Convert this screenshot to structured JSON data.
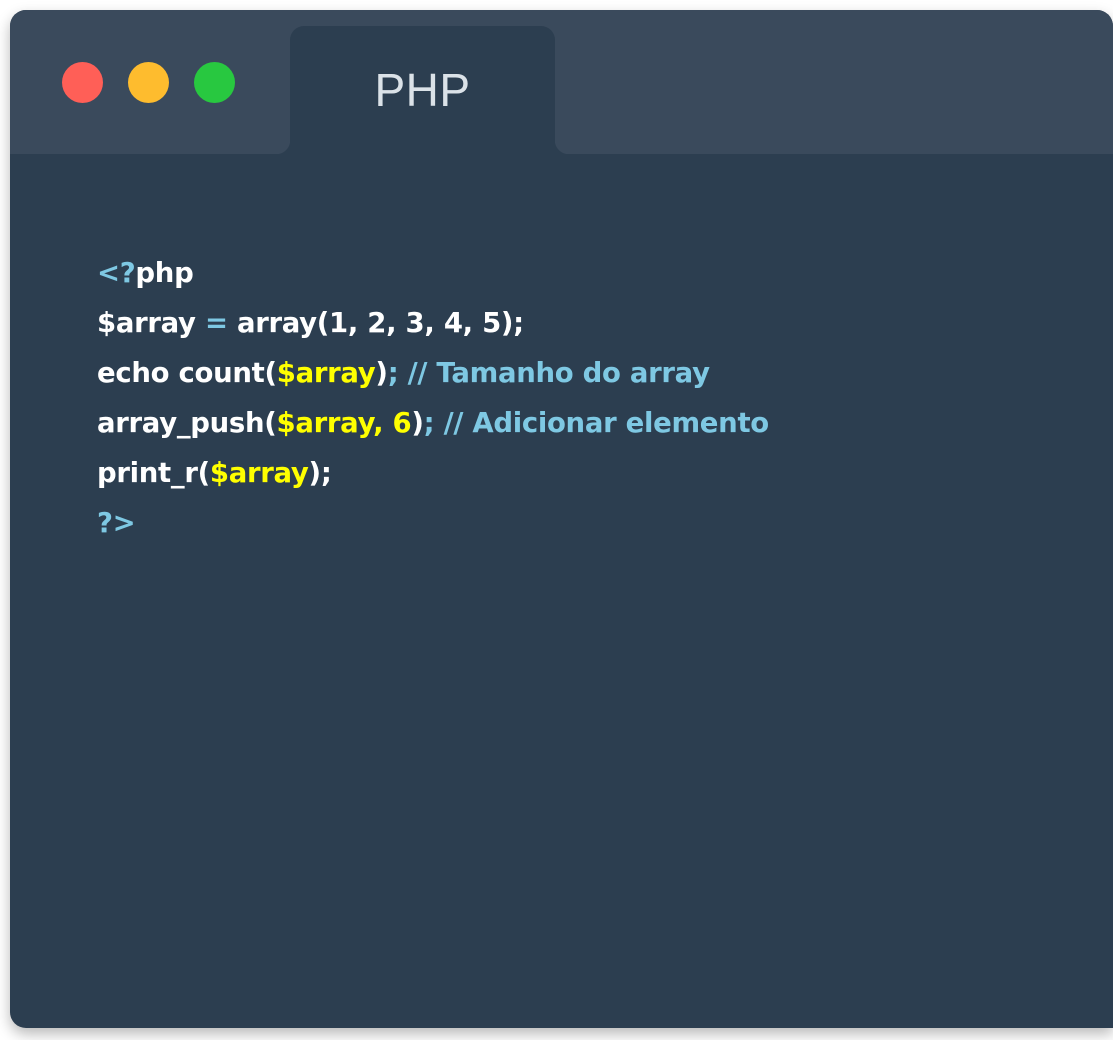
{
  "window": {
    "tab_label": "PHP",
    "traffic_lights": [
      {
        "name": "close",
        "color": "#ff5f57"
      },
      {
        "name": "minimize",
        "color": "#febc2e"
      },
      {
        "name": "maximize",
        "color": "#28c840"
      }
    ]
  },
  "colors": {
    "background": "#2c3e50",
    "titlebar": "#3a4a5c",
    "code_text": "#ffffff",
    "code_comment": "#7ec8e3",
    "code_highlight": "#ffff00"
  },
  "code": {
    "language": "PHP",
    "lines": [
      [
        {
          "text": "<?",
          "style": "blue"
        },
        {
          "text": "php",
          "style": "white"
        }
      ],
      [
        {
          "text": "$array ",
          "style": "white"
        },
        {
          "text": "=",
          "style": "blue"
        },
        {
          "text": " array(1, 2, 3, 4, 5);",
          "style": "white"
        }
      ],
      [
        {
          "text": "echo count(",
          "style": "white"
        },
        {
          "text": "$array",
          "style": "yellow"
        },
        {
          "text": ")",
          "style": "white"
        },
        {
          "text": "; // Tamanho do array",
          "style": "blue"
        }
      ],
      [
        {
          "text": "array_push(",
          "style": "white"
        },
        {
          "text": "$array, 6",
          "style": "yellow"
        },
        {
          "text": ")",
          "style": "white"
        },
        {
          "text": "; // Adicionar elemento",
          "style": "blue"
        }
      ],
      [
        {
          "text": "print_r(",
          "style": "white"
        },
        {
          "text": "$array",
          "style": "yellow"
        },
        {
          "text": ");",
          "style": "white"
        }
      ],
      [
        {
          "text": "?>",
          "style": "blue"
        }
      ]
    ]
  }
}
